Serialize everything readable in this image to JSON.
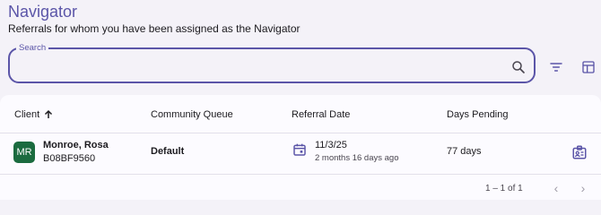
{
  "page": {
    "title": "Navigator",
    "subtitle": "Referrals for whom you have been assigned as the Navigator"
  },
  "search": {
    "label": "Search",
    "value": "",
    "placeholder": ""
  },
  "toolbar": {
    "filter_icon": "filter-icon",
    "columns_icon": "table-columns-icon"
  },
  "table": {
    "columns": [
      {
        "label": "Client",
        "sort": "ascending"
      },
      {
        "label": "Community Queue"
      },
      {
        "label": "Referral Date"
      },
      {
        "label": "Days Pending"
      }
    ],
    "rows": [
      {
        "avatar_initials": "MR",
        "avatar_color": "#1b6b3f",
        "client_name": "Monroe, Rosa",
        "client_id": "B08BF9560",
        "queue": "Default",
        "referral_date": "11/3/25",
        "referral_relative": "2 months 16 days ago",
        "days_pending": "77 days"
      }
    ]
  },
  "pagination": {
    "range": "1 – 1 of 1"
  },
  "colors": {
    "accent": "#5b55a8",
    "avatar": "#1b6b3f"
  }
}
